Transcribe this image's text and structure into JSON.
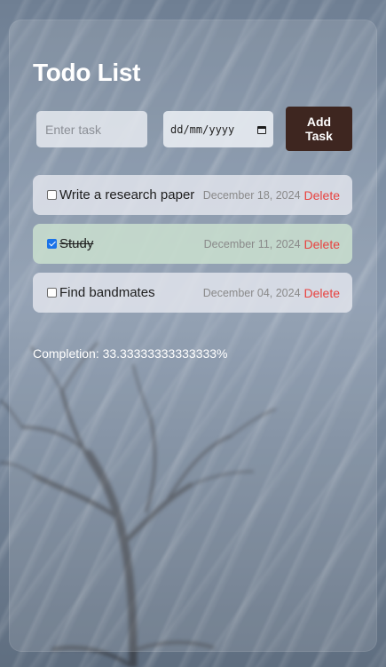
{
  "app": {
    "title": "Todo List"
  },
  "form": {
    "task_placeholder": "Enter task",
    "task_value": "",
    "date_placeholder": "dd/mm/yyyy",
    "add_label": "Add\nTask"
  },
  "tasks": [
    {
      "text": "Write a research paper",
      "date": "December 18, 2024",
      "done": false,
      "delete_label": "Delete"
    },
    {
      "text": "Study",
      "date": "December 11, 2024",
      "done": true,
      "delete_label": "Delete"
    },
    {
      "text": "Find bandmates",
      "date": "December 04, 2024",
      "done": false,
      "delete_label": "Delete"
    }
  ],
  "completion": {
    "text": "Completion: 33.33333333333333%"
  },
  "colors": {
    "add_button_bg": "#3e2620",
    "delete_text": "#e8423f",
    "done_item_bg": "#c8dece",
    "checkbox_checked": "#1a73e8"
  },
  "icons": {
    "date_picker": "calendar-icon"
  }
}
